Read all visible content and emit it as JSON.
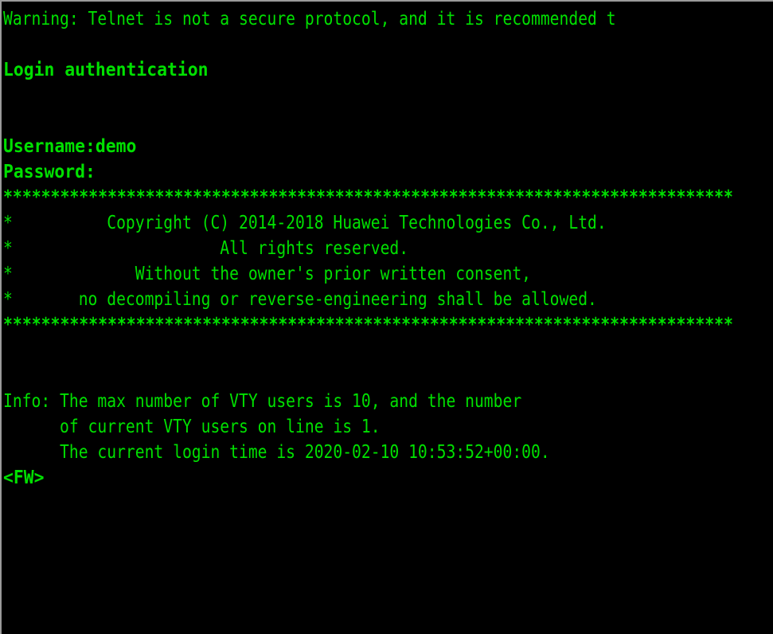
{
  "terminal": {
    "type": "telnet-console",
    "device": "Huawei firewall CLI",
    "colors": {
      "background": "#000000",
      "foreground": "#00e000",
      "border": "#9a9a9a"
    },
    "lines": [
      {
        "id": "warning",
        "style": "cond",
        "text": "Warning: Telnet is not a secure protocol, and it is recommended t"
      },
      {
        "id": "blank-1",
        "style": "blank",
        "text": ""
      },
      {
        "id": "login-auth",
        "style": "wide",
        "text": "Login authentication"
      },
      {
        "id": "blank-2",
        "style": "blank",
        "text": ""
      },
      {
        "id": "blank-3",
        "style": "blank",
        "text": ""
      },
      {
        "id": "username-prompt",
        "style": "wide",
        "text": "Username:demo"
      },
      {
        "id": "password-prompt",
        "style": "wide",
        "text": "Password:"
      },
      {
        "id": "banner-top-rule",
        "style": "stars",
        "text": "*****************************************************************************"
      },
      {
        "id": "banner-copyright",
        "style": "cond",
        "text": "*          Copyright (C) 2014-2018 Huawei Technologies Co., Ltd."
      },
      {
        "id": "banner-rights",
        "style": "cond",
        "text": "*                      All rights reserved."
      },
      {
        "id": "banner-consent",
        "style": "cond",
        "text": "*             Without the owner's prior written consent,"
      },
      {
        "id": "banner-decompile",
        "style": "cond",
        "text": "*       no decompiling or reverse-engineering shall be allowed."
      },
      {
        "id": "banner-bottom-rule",
        "style": "stars",
        "text": "*****************************************************************************"
      },
      {
        "id": "blank-4",
        "style": "blank",
        "text": ""
      },
      {
        "id": "blank-5",
        "style": "blank",
        "text": ""
      },
      {
        "id": "info-vty-max",
        "style": "cond",
        "text": "Info: The max number of VTY users is 10, and the number"
      },
      {
        "id": "info-vty-current",
        "style": "cond",
        "text": "      of current VTY users on line is 1."
      },
      {
        "id": "info-login-time",
        "style": "cond",
        "text": "      The current login time is 2020-02-10 10:53:52+00:00."
      },
      {
        "id": "shell-prompt",
        "style": "wide",
        "text": "<FW>"
      }
    ],
    "session": {
      "username": "demo",
      "password_masked": "",
      "prompt": "<FW>",
      "vty_max_users": "10",
      "vty_current_users": "1",
      "login_time": "2020-02-10 10:53:52+00:00",
      "copyright_years": "2014-2018",
      "vendor": "Huawei Technologies Co., Ltd."
    }
  }
}
